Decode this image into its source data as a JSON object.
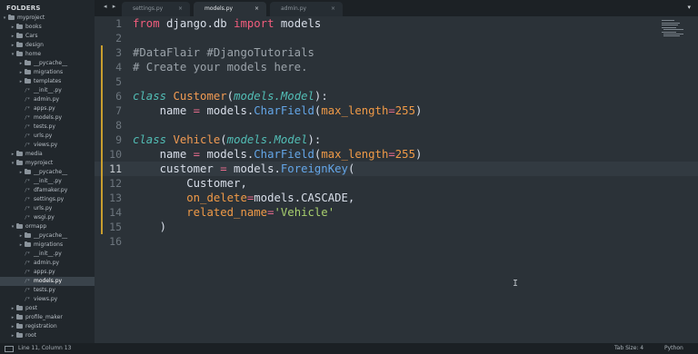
{
  "sidebar": {
    "title": "FOLDERS",
    "items": [
      {
        "label": "myproject",
        "type": "folder",
        "level": 0,
        "expanded": true
      },
      {
        "label": "books",
        "type": "folder",
        "level": 1,
        "expanded": false
      },
      {
        "label": "Cars",
        "type": "folder",
        "level": 1,
        "expanded": false
      },
      {
        "label": "design",
        "type": "folder",
        "level": 1,
        "expanded": false
      },
      {
        "label": "home",
        "type": "folder",
        "level": 1,
        "expanded": true
      },
      {
        "label": "__pycache__",
        "type": "folder",
        "level": 2,
        "expanded": false
      },
      {
        "label": "migrations",
        "type": "folder",
        "level": 2,
        "expanded": false
      },
      {
        "label": "templates",
        "type": "folder",
        "level": 2,
        "expanded": false
      },
      {
        "label": "__init__.py",
        "type": "file",
        "level": 2
      },
      {
        "label": "admin.py",
        "type": "file",
        "level": 2
      },
      {
        "label": "apps.py",
        "type": "file",
        "level": 2
      },
      {
        "label": "models.py",
        "type": "file",
        "level": 2
      },
      {
        "label": "tests.py",
        "type": "file",
        "level": 2
      },
      {
        "label": "urls.py",
        "type": "file",
        "level": 2
      },
      {
        "label": "views.py",
        "type": "file",
        "level": 2
      },
      {
        "label": "media",
        "type": "folder",
        "level": 1,
        "expanded": false
      },
      {
        "label": "myproject",
        "type": "folder",
        "level": 1,
        "expanded": true
      },
      {
        "label": "__pycache__",
        "type": "folder",
        "level": 2,
        "expanded": false
      },
      {
        "label": "__init__.py",
        "type": "file",
        "level": 2
      },
      {
        "label": "dfamaker.py",
        "type": "file",
        "level": 2
      },
      {
        "label": "settings.py",
        "type": "file",
        "level": 2
      },
      {
        "label": "urls.py",
        "type": "file",
        "level": 2
      },
      {
        "label": "wsgi.py",
        "type": "file",
        "level": 2
      },
      {
        "label": "ormapp",
        "type": "folder",
        "level": 1,
        "expanded": true
      },
      {
        "label": "__pycache__",
        "type": "folder",
        "level": 2,
        "expanded": false
      },
      {
        "label": "migrations",
        "type": "folder",
        "level": 2,
        "expanded": false
      },
      {
        "label": "__init__.py",
        "type": "file",
        "level": 2
      },
      {
        "label": "admin.py",
        "type": "file",
        "level": 2
      },
      {
        "label": "apps.py",
        "type": "file",
        "level": 2
      },
      {
        "label": "models.py",
        "type": "file",
        "level": 2,
        "selected": true
      },
      {
        "label": "tests.py",
        "type": "file",
        "level": 2
      },
      {
        "label": "views.py",
        "type": "file",
        "level": 2
      },
      {
        "label": "post",
        "type": "folder",
        "level": 1,
        "expanded": false
      },
      {
        "label": "profile_maker",
        "type": "folder",
        "level": 1,
        "expanded": false
      },
      {
        "label": "registration",
        "type": "folder",
        "level": 1,
        "expanded": false
      },
      {
        "label": "root",
        "type": "folder",
        "level": 1,
        "expanded": false
      }
    ]
  },
  "tabs": {
    "nav_arrows": "◂ ▸",
    "items": [
      {
        "label": "settings.py",
        "close": "×",
        "active": false
      },
      {
        "label": "models.py",
        "close": "×",
        "active": true
      },
      {
        "label": "admin.py",
        "close": "×",
        "active": false
      }
    ],
    "dropdown": "▾"
  },
  "editor": {
    "current_line": 11,
    "lines": [
      {
        "n": "1",
        "tokens": [
          [
            "k",
            "from"
          ],
          [
            "w",
            " django.db "
          ],
          [
            "k",
            "import"
          ],
          [
            "w",
            " models"
          ]
        ]
      },
      {
        "n": "2",
        "tokens": []
      },
      {
        "n": "3",
        "tokens": [
          [
            "c",
            "#DataFlair #DjangoTutorials"
          ]
        ]
      },
      {
        "n": "4",
        "tokens": [
          [
            "c",
            "# Create your models here."
          ]
        ]
      },
      {
        "n": "5",
        "tokens": []
      },
      {
        "n": "6",
        "tokens": [
          [
            "it",
            "class"
          ],
          [
            "w",
            " "
          ],
          [
            "cls",
            "Customer"
          ],
          [
            "w",
            "("
          ],
          [
            "it",
            "models.Model"
          ],
          [
            "w",
            "):"
          ]
        ]
      },
      {
        "n": "7",
        "tokens": [
          [
            "w",
            "    name "
          ],
          [
            "op",
            "="
          ],
          [
            "w",
            " models."
          ],
          [
            "fn",
            "CharField"
          ],
          [
            "w",
            "("
          ],
          [
            "par",
            "max_length"
          ],
          [
            "op",
            "="
          ],
          [
            "num",
            "255"
          ],
          [
            "w",
            ")"
          ]
        ]
      },
      {
        "n": "8",
        "tokens": []
      },
      {
        "n": "9",
        "tokens": [
          [
            "it",
            "class"
          ],
          [
            "w",
            " "
          ],
          [
            "cls",
            "Vehicle"
          ],
          [
            "w",
            "("
          ],
          [
            "it",
            "models.Model"
          ],
          [
            "w",
            "):"
          ]
        ]
      },
      {
        "n": "10",
        "tokens": [
          [
            "w",
            "    name "
          ],
          [
            "op",
            "="
          ],
          [
            "w",
            " models."
          ],
          [
            "fn",
            "CharField"
          ],
          [
            "w",
            "("
          ],
          [
            "par",
            "max_length"
          ],
          [
            "op",
            "="
          ],
          [
            "num",
            "255"
          ],
          [
            "w",
            ")"
          ]
        ]
      },
      {
        "n": "11",
        "tokens": [
          [
            "w",
            "    customer "
          ],
          [
            "op",
            "="
          ],
          [
            "w",
            " models."
          ],
          [
            "fn",
            "ForeignKey"
          ],
          [
            "w",
            "("
          ]
        ]
      },
      {
        "n": "12",
        "tokens": [
          [
            "w",
            "        Customer,"
          ]
        ]
      },
      {
        "n": "13",
        "tokens": [
          [
            "w",
            "        "
          ],
          [
            "par",
            "on_delete"
          ],
          [
            "op",
            "="
          ],
          [
            "w",
            "models.CASCADE,"
          ]
        ]
      },
      {
        "n": "14",
        "tokens": [
          [
            "w",
            "        "
          ],
          [
            "par",
            "related_name"
          ],
          [
            "op",
            "="
          ],
          [
            "str",
            "'Vehicle'"
          ]
        ]
      },
      {
        "n": "15",
        "tokens": [
          [
            "w",
            "    )"
          ]
        ]
      },
      {
        "n": "16",
        "tokens": []
      }
    ],
    "cursor_glyph": "I"
  },
  "statusbar": {
    "position": "Line 11, Column 13",
    "tab_size": "Tab Size: 4",
    "syntax": "Python"
  }
}
